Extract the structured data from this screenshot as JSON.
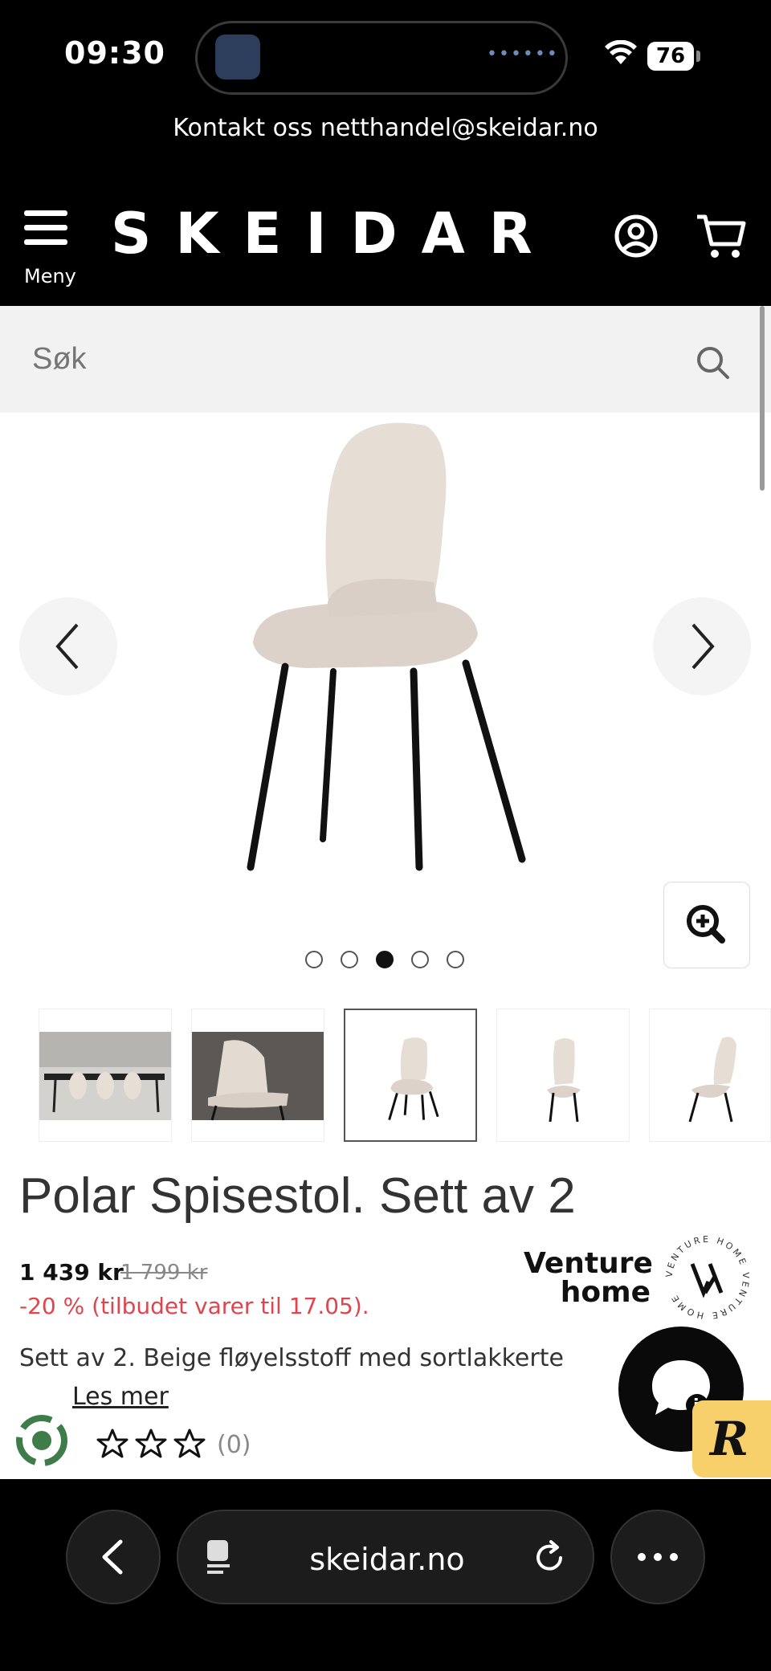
{
  "status_bar": {
    "time": "09:30",
    "battery": "76"
  },
  "header": {
    "contact": "Kontakt oss netthandel@skeidar.no",
    "menu_label": "Meny",
    "logo": "SKEIDAR"
  },
  "search": {
    "placeholder": "Søk"
  },
  "carousel": {
    "dot_count": 5,
    "active_index": 2
  },
  "product": {
    "title": "Polar Spisestol. Sett av 2",
    "price": "1 439 kr",
    "old_price": "1 799 kr",
    "discount": "-20 % (tilbudet varer til 17.05).",
    "description": "Sett av 2. Beige fløyelsstoff med sortlakkerte",
    "read_more": "Les mer",
    "rating_count": "(0)",
    "brand": {
      "line1": "Venture",
      "line2": "home",
      "seal_text": "VENTURE HOME"
    }
  },
  "browser": {
    "url": "skeidar.no"
  },
  "colors": {
    "accent_red": "#e0454f",
    "chat_black": "#0a0a0a",
    "badge_yellow": "#f8d06b"
  },
  "icons": [
    "menu-icon",
    "account-icon",
    "cart-icon",
    "search-icon",
    "chevron-left-icon",
    "chevron-right-icon",
    "zoom-in-icon",
    "star-icon",
    "chat-icon",
    "recycle-icon",
    "back-icon",
    "reload-icon",
    "more-icon"
  ]
}
